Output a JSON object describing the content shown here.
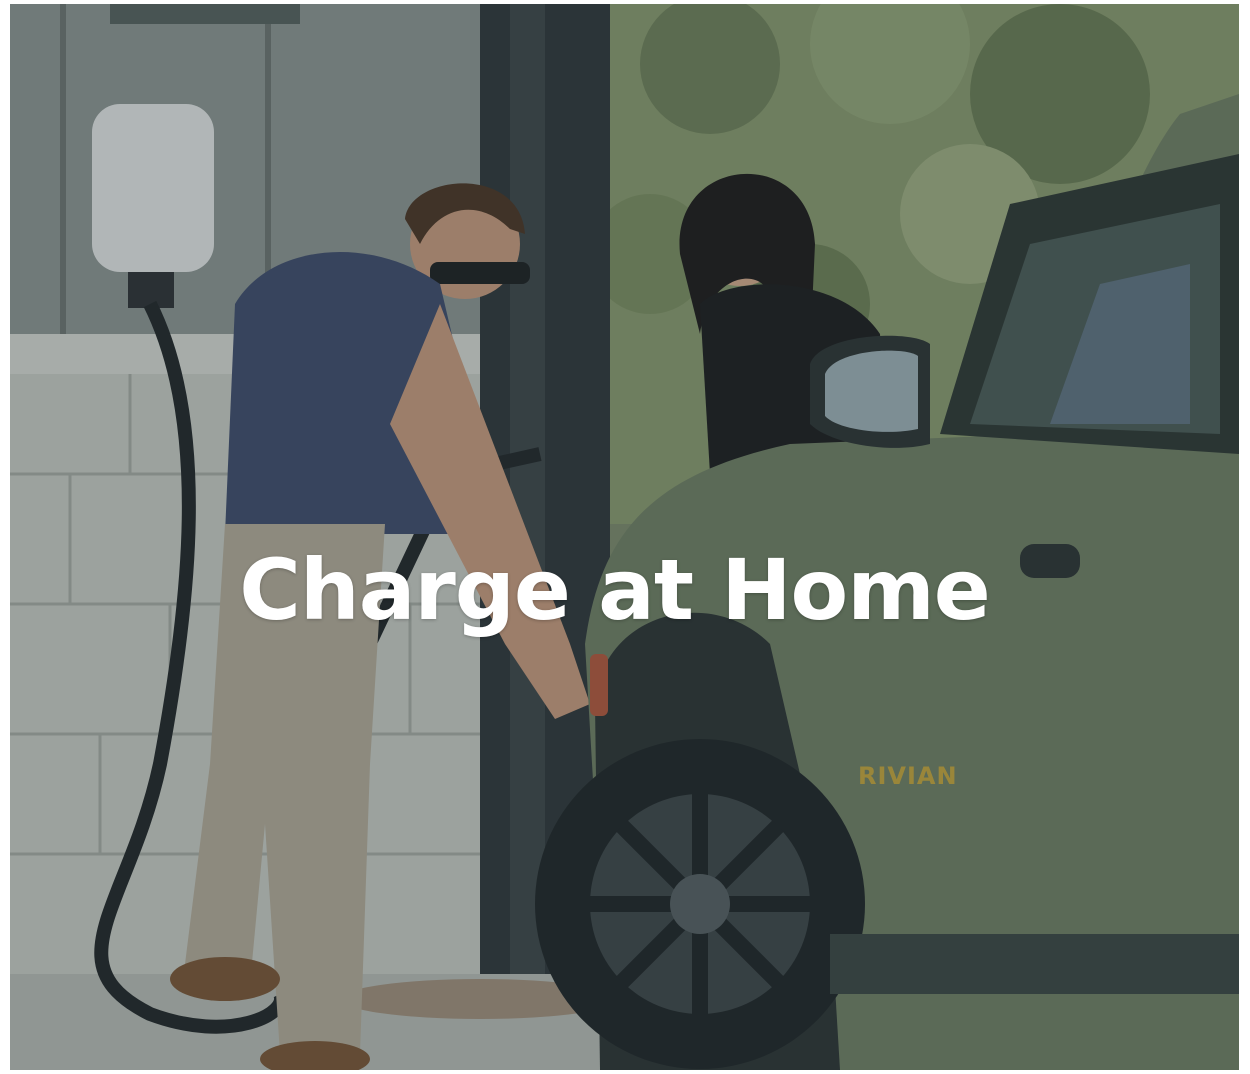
{
  "hero": {
    "title": "Charge at Home",
    "overlay_color": "#283a3c",
    "vehicle_badge": "RIVIAN"
  }
}
